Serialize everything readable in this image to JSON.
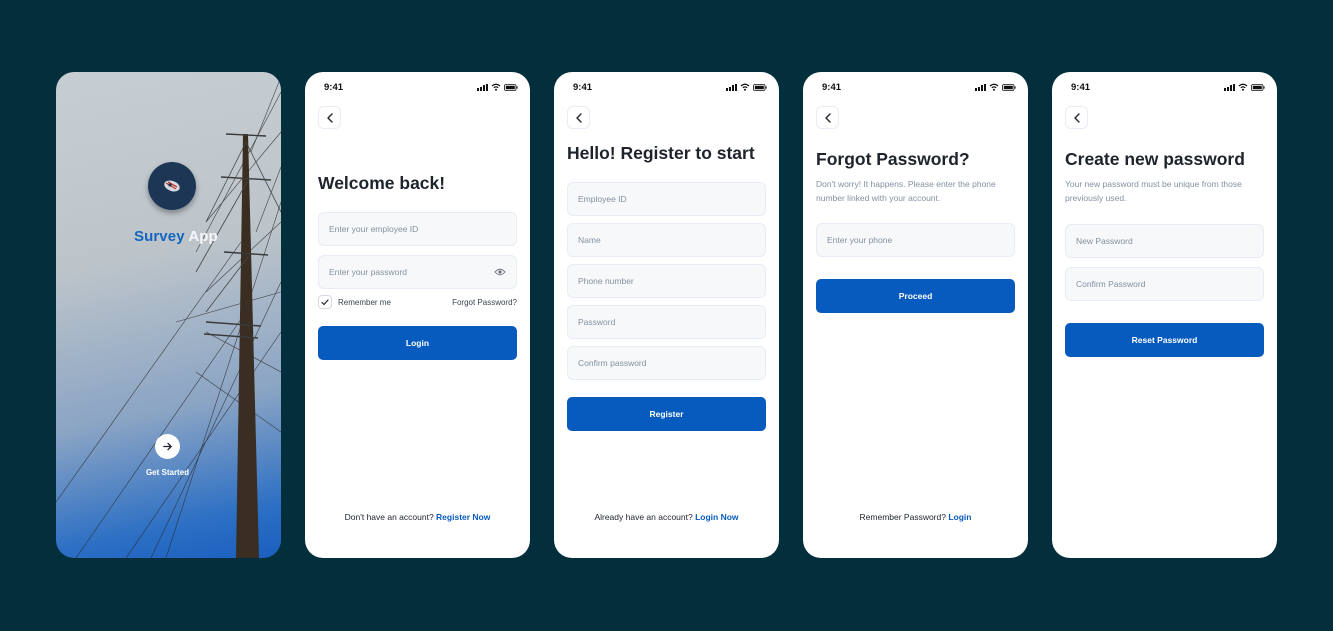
{
  "splash": {
    "app_name_first": "Survey",
    "app_name_second": "App",
    "get_started": "Get Started"
  },
  "status_time": "9:41",
  "login": {
    "title": "Welcome back!",
    "employee_placeholder": "Enter your employee ID",
    "password_placeholder": "Enter your password",
    "remember": "Remember me",
    "forgot": "Forgot Password?",
    "button": "Login",
    "footer_text": "Don't have an account?",
    "footer_link": "Register Now"
  },
  "register": {
    "title": "Hello! Register to start",
    "fields": [
      "Employee ID",
      "Name",
      "Phone number",
      "Password",
      "Confirm password"
    ],
    "button": "Register",
    "footer_text": "Already have an account?",
    "footer_link": "Login Now"
  },
  "forgot": {
    "title": "Forgot Password?",
    "subtitle": "Don't worry! It happens. Please enter the phone number linked with your account.",
    "phone_placeholder": "Enter your phone",
    "button": "Proceed",
    "footer_text": "Remember Password?",
    "footer_link": "Login"
  },
  "reset": {
    "title": "Create new password",
    "subtitle": "Your new password must be unique from those previously used.",
    "new_placeholder": "New Password",
    "confirm_placeholder": "Confirm Password",
    "button": "Reset Password"
  },
  "colors": {
    "background": "#032f3d",
    "primary": "#075bbf",
    "field_bg": "#f7f8f9",
    "placeholder": "#8391a1"
  }
}
